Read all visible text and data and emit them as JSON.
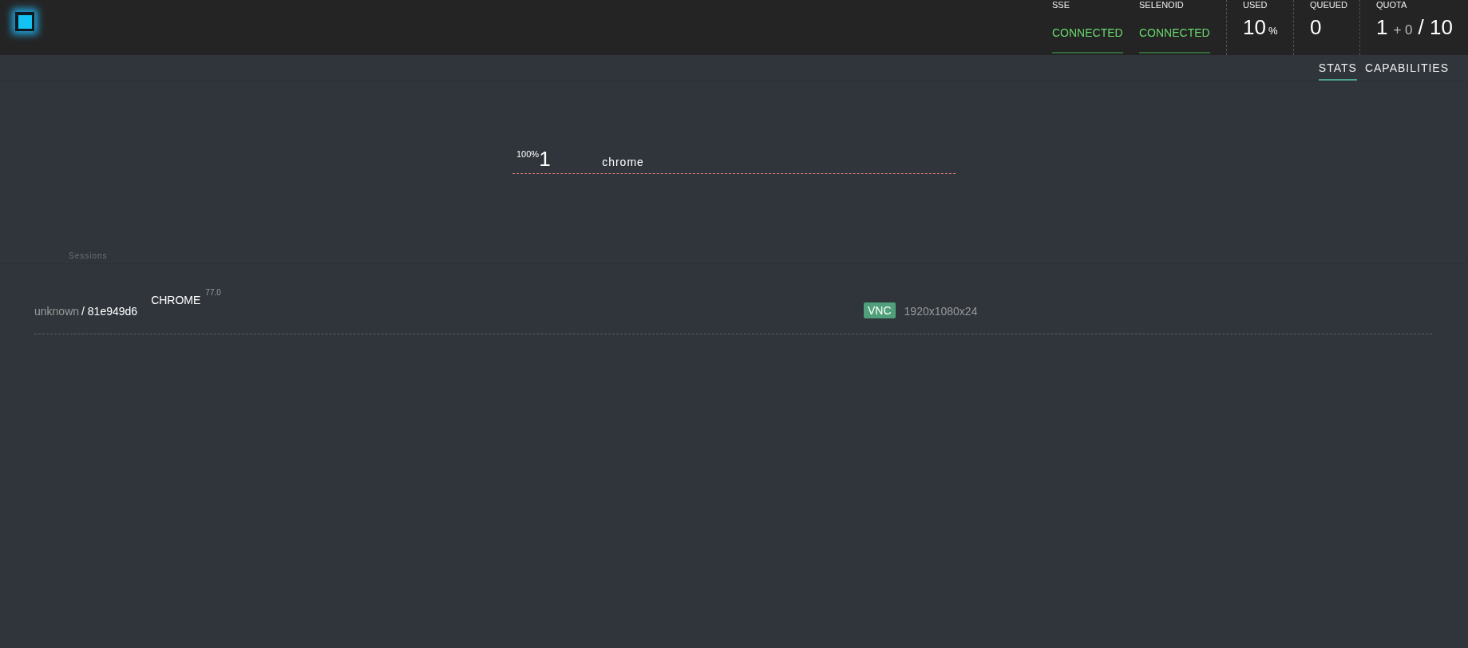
{
  "status": [
    {
      "label": "SSE",
      "value": "CONNECTED",
      "connected": true
    },
    {
      "label": "SELENOID",
      "value": "CONNECTED",
      "connected": true
    }
  ],
  "used": {
    "label": "USED",
    "value": "10",
    "unit": "%"
  },
  "queued": {
    "label": "QUEUED",
    "value": "0"
  },
  "quota": {
    "label": "QUOTA",
    "used": "1",
    "plus": "+ 0",
    "total": "/ 10"
  },
  "tabs": [
    {
      "label": "STATS",
      "selected": true
    },
    {
      "label": "CAPABILITIES",
      "selected": false
    }
  ],
  "browsers": [
    {
      "percent": "100%",
      "count": "1",
      "name": "chrome"
    }
  ],
  "sessions_label": "Sessions",
  "sessions": [
    {
      "user": "unknown",
      "id": "/ 81e949d6",
      "browser": "CHROME",
      "version": "77.0",
      "badge": "VNC",
      "resolution": "1920x1080x24"
    }
  ]
}
